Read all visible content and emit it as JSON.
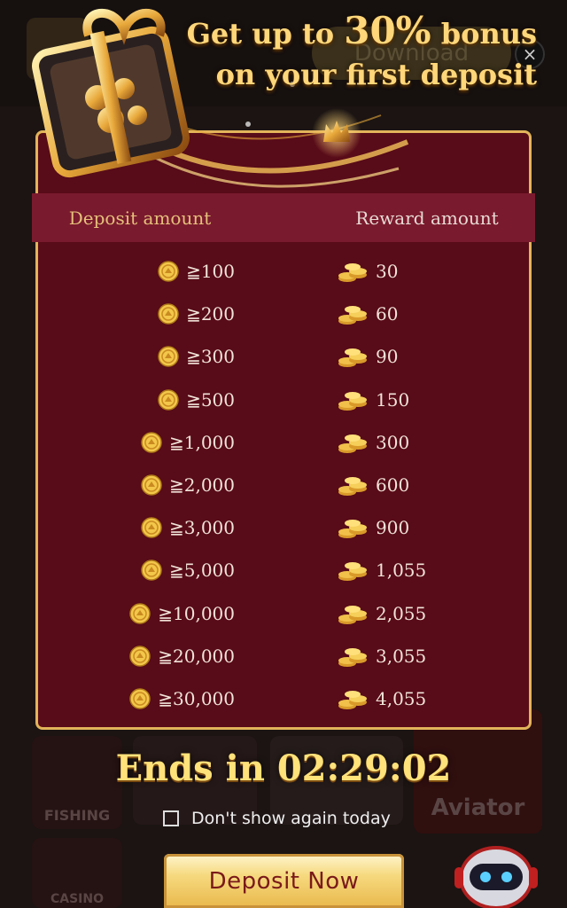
{
  "background": {
    "download_label": "Download",
    "close_symbol": "×",
    "tiles": [
      {
        "label": "FISHING"
      },
      {
        "label": "Aviator"
      },
      {
        "label": "CASINO"
      }
    ]
  },
  "promo": {
    "line1_prefix": "Get up to ",
    "line1_percent": "30%",
    "line1_suffix": " bonus",
    "line2": "on your first deposit"
  },
  "table": {
    "header_deposit": "Deposit amount",
    "header_reward": "Reward amount",
    "rows": [
      {
        "deposit": "≧100",
        "reward": "30"
      },
      {
        "deposit": "≧200",
        "reward": "60"
      },
      {
        "deposit": "≧300",
        "reward": "90"
      },
      {
        "deposit": "≧500",
        "reward": "150"
      },
      {
        "deposit": "≧1,000",
        "reward": "300"
      },
      {
        "deposit": "≧2,000",
        "reward": "600"
      },
      {
        "deposit": "≧3,000",
        "reward": "900"
      },
      {
        "deposit": "≧5,000",
        "reward": "1,055"
      },
      {
        "deposit": "≧10,000",
        "reward": "2,055"
      },
      {
        "deposit": "≧20,000",
        "reward": "3,055"
      },
      {
        "deposit": "≧30,000",
        "reward": "4,055"
      }
    ]
  },
  "countdown": {
    "prefix": "Ends in ",
    "time": "02:29:02"
  },
  "dont_show": {
    "label": "Don't show again today",
    "checked": false
  },
  "cta": {
    "label": "Deposit Now"
  },
  "colors": {
    "panel": "#580b18",
    "border": "#e2b45a",
    "accent": "#ffd77a",
    "header_row": "#7a1a2e"
  }
}
